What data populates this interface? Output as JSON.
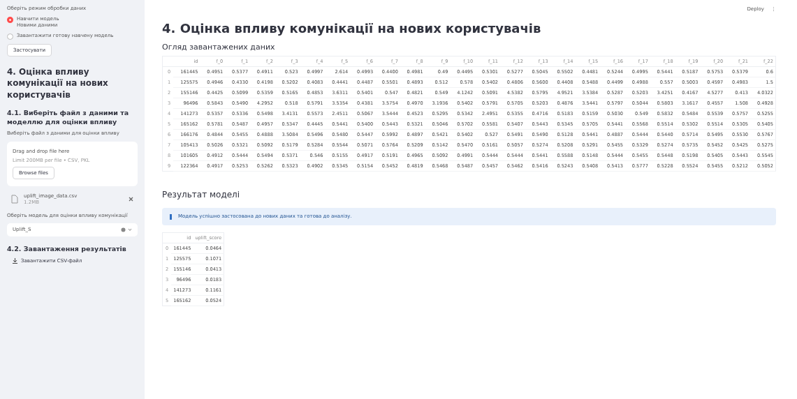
{
  "sidebar": {
    "mode_label": "Оберіть режим обробки даних",
    "modes": [
      {
        "label": "Навчити модель",
        "caption": "Новими даними",
        "selected": true
      },
      {
        "label": "Завантажити готову навчену модель",
        "selected": false
      }
    ],
    "apply_button": "Застосувати",
    "heading": "4. Оцінка впливу комунікації на нових користувачів",
    "subheading": "4.1. Виберіть файл з даними та моделлю для оцінки впливу",
    "file_label": "Виберіть файл з даними для оцінки впливу",
    "dropzone": {
      "title": "Drag and drop file here",
      "hint": "Limit 200MB per file • CSV, PKL",
      "button": "Browse files"
    },
    "file": {
      "name": "uplift_image_data.csv",
      "size": "1.2MB"
    },
    "model_label": "Оберіть модель для оцінки впливу комунікації",
    "model_select": {
      "value": "Uplift_S"
    },
    "download_heading": "4.2. Завантаження результатів",
    "download_link": "Завантажити CSV-файл"
  },
  "header": {
    "deploy": "Deploy",
    "menu": "⋮"
  },
  "main": {
    "title": "4. Оцінка впливу комунікації на нових користувачів",
    "data_heading": "Огляд завантажених даних",
    "data_table": {
      "columns": [
        "id",
        "f_0",
        "f_1",
        "f_2",
        "f_3",
        "f_4",
        "f_5",
        "f_6",
        "f_7",
        "f_8",
        "f_9",
        "f_10",
        "f_11",
        "f_12",
        "f_13",
        "f_14",
        "f_15",
        "f_16",
        "f_17",
        "f_18",
        "f_19",
        "f_20",
        "f_21",
        "f_22"
      ],
      "rows": [
        {
          "index": "0",
          "cells": [
            "161445",
            "0.4951",
            "0.5377",
            "0.4911",
            "0.523",
            "0.4997",
            "2.614",
            "0.4993",
            "0.4400",
            "0.4981",
            "0.49",
            "0.4495",
            "0.5301",
            "0.5277",
            "0.5045",
            "0.5502",
            "0.4481",
            "0.5244",
            "0.4995",
            "0.5441",
            "0.5187",
            "0.5753",
            "0.5379",
            "0.6"
          ]
        },
        {
          "index": "1",
          "cells": [
            "125575",
            "0.4946",
            "0.4330",
            "0.4198",
            "0.5202",
            "0.4083",
            "0.4441",
            "0.4487",
            "0.5501",
            "0.4893",
            "0.512",
            "0.578",
            "0.5402",
            "0.4806",
            "0.5600",
            "0.4408",
            "0.5488",
            "0.4499",
            "0.4988",
            "0.557",
            "0.5003",
            "0.4597",
            "0.4983",
            "1.5"
          ]
        },
        {
          "index": "2",
          "cells": [
            "155146",
            "0.4425",
            "0.5099",
            "0.5359",
            "0.5165",
            "0.4853",
            "3.6311",
            "0.5401",
            "0.547",
            "0.4821",
            "0.549",
            "4.1242",
            "0.5091",
            "4.5382",
            "0.5795",
            "4.9521",
            "3.5384",
            "0.5287",
            "0.5203",
            "3.4251",
            "0.4167",
            "4.5277",
            "0.413",
            "4.0322"
          ]
        },
        {
          "index": "3",
          "cells": [
            "96496",
            "0.5843",
            "0.5490",
            "4.2952",
            "0.518",
            "0.5791",
            "3.5354",
            "0.4381",
            "3.5754",
            "0.4970",
            "3.1936",
            "0.5402",
            "0.5791",
            "0.5705",
            "0.5203",
            "0.4876",
            "3.5441",
            "0.5797",
            "0.5044",
            "0.5803",
            "3.1617",
            "0.4557",
            "1.508",
            "0.4928"
          ]
        },
        {
          "index": "4",
          "cells": [
            "141273",
            "0.5357",
            "0.5336",
            "0.5498",
            "3.4131",
            "0.5573",
            "2.4511",
            "0.5067",
            "3.5444",
            "0.4523",
            "0.5295",
            "0.5342",
            "2.4951",
            "0.5355",
            "0.4716",
            "0.5183",
            "0.5159",
            "0.5030",
            "0.549",
            "0.5832",
            "0.5484",
            "0.5539",
            "0.5757",
            "0.5255"
          ]
        },
        {
          "index": "5",
          "cells": [
            "165162",
            "0.5781",
            "0.5487",
            "0.4957",
            "0.5347",
            "0.4445",
            "0.5441",
            "0.5400",
            "0.5443",
            "0.5321",
            "0.5046",
            "0.5702",
            "0.5581",
            "0.5407",
            "0.5443",
            "0.5345",
            "0.5705",
            "0.5441",
            "0.5568",
            "0.5514",
            "0.5302",
            "0.5514",
            "0.5305",
            "0.5405"
          ]
        },
        {
          "index": "6",
          "cells": [
            "166176",
            "0.4844",
            "0.5455",
            "0.4888",
            "3.5084",
            "0.5496",
            "0.5480",
            "0.5447",
            "0.5992",
            "0.4897",
            "0.5421",
            "0.5402",
            "0.527",
            "0.5491",
            "0.5490",
            "0.5128",
            "0.5441",
            "0.4887",
            "0.5444",
            "0.5440",
            "0.5714",
            "0.5495",
            "0.5530",
            "0.5767"
          ]
        },
        {
          "index": "7",
          "cells": [
            "105413",
            "0.5026",
            "0.5321",
            "0.5092",
            "0.5179",
            "0.5284",
            "0.5544",
            "0.5071",
            "0.5764",
            "0.5209",
            "0.5142",
            "0.5470",
            "0.5161",
            "0.5057",
            "0.5274",
            "0.5208",
            "0.5291",
            "0.5455",
            "0.5329",
            "0.5274",
            "0.5735",
            "0.5452",
            "0.5425",
            "0.5275"
          ]
        },
        {
          "index": "8",
          "cells": [
            "101605",
            "0.4912",
            "0.5444",
            "0.5494",
            "0.5371",
            "0.546",
            "0.5155",
            "0.4917",
            "0.5191",
            "0.4965",
            "0.5092",
            "0.4991",
            "0.5444",
            "0.5444",
            "0.5441",
            "0.5588",
            "0.5148",
            "0.5444",
            "0.5455",
            "0.5448",
            "0.5198",
            "0.5405",
            "0.5443",
            "0.5545"
          ]
        },
        {
          "index": "9",
          "cells": [
            "122364",
            "0.4917",
            "0.5253",
            "0.5262",
            "0.5323",
            "0.4902",
            "0.5345",
            "0.5154",
            "0.5452",
            "0.4819",
            "0.5468",
            "0.5487",
            "0.5457",
            "0.5462",
            "0.5416",
            "0.5243",
            "0.5408",
            "0.5413",
            "0.5777",
            "0.5228",
            "0.5524",
            "0.5455",
            "0.5212",
            "0.5052"
          ]
        }
      ]
    },
    "result_heading": "Результат моделі",
    "info": "Модель успішно застосована до нових даних та готова до аналізу.",
    "result_table": {
      "columns": [
        "id",
        "uplift_score"
      ],
      "rows": [
        {
          "index": "0",
          "cells": [
            "161445",
            "0.0464"
          ]
        },
        {
          "index": "1",
          "cells": [
            "125575",
            "0.1071"
          ]
        },
        {
          "index": "2",
          "cells": [
            "155146",
            "0.0413"
          ]
        },
        {
          "index": "3",
          "cells": [
            "96496",
            "0.0183"
          ]
        },
        {
          "index": "4",
          "cells": [
            "141273",
            "0.1161"
          ]
        },
        {
          "index": "5",
          "cells": [
            "165162",
            "0.0524"
          ]
        }
      ]
    }
  }
}
